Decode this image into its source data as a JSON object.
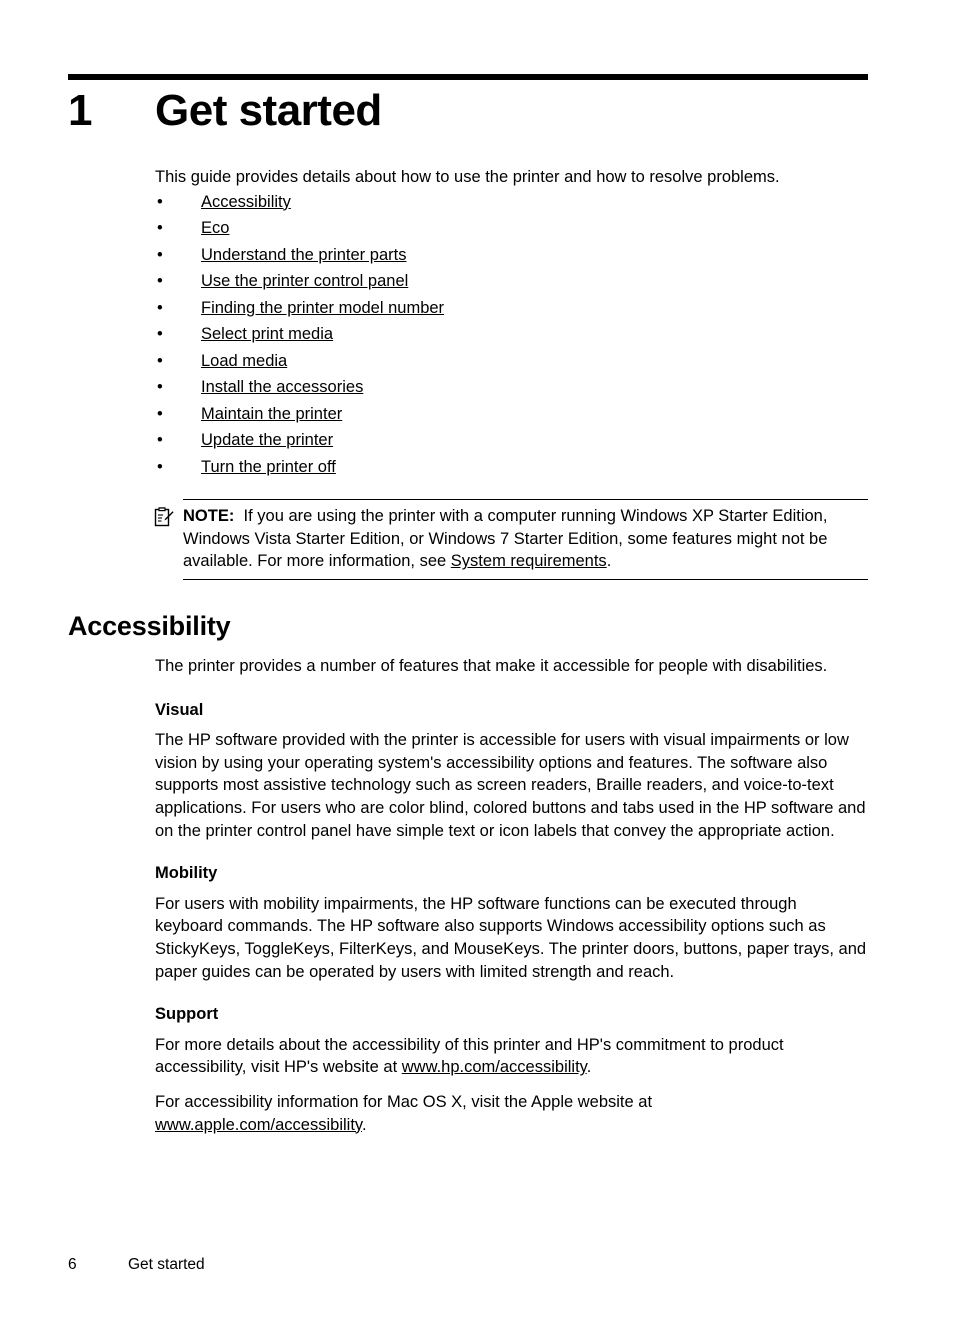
{
  "chapter": {
    "number": "1",
    "title": "Get started"
  },
  "intro": "This guide provides details about how to use the printer and how to resolve problems.",
  "bullet": "•",
  "links": [
    {
      "label": "Accessibility"
    },
    {
      "label": "Eco"
    },
    {
      "label": "Understand the printer parts"
    },
    {
      "label": "Use the printer control panel"
    },
    {
      "label": "Finding the printer model number"
    },
    {
      "label": "Select print media"
    },
    {
      "label": "Load media"
    },
    {
      "label": "Install the accessories"
    },
    {
      "label": "Maintain the printer"
    },
    {
      "label": "Update the printer"
    },
    {
      "label": "Turn the printer off"
    }
  ],
  "note": {
    "icon": "note-clipboard-pencil-icon",
    "label": "NOTE:",
    "text_before_link": "If you are using the printer with a computer running Windows XP Starter Edition, Windows Vista Starter Edition, or Windows 7 Starter Edition, some features might not be available. For more information, see ",
    "link": "System requirements",
    "text_after_link": "."
  },
  "section": {
    "heading": "Accessibility",
    "intro": "The printer provides a number of features that make it accessible for people with disabilities.",
    "subsections": [
      {
        "heading": "Visual",
        "paragraphs": [
          "The HP software provided with the printer is accessible for users with visual impairments or low vision by using your operating system's accessibility options and features. The software also supports most assistive technology such as screen readers, Braille readers, and voice-to-text applications. For users who are color blind, colored buttons and tabs used in the HP software and on the printer control panel have simple text or icon labels that convey the appropriate action."
        ]
      },
      {
        "heading": "Mobility",
        "paragraphs": [
          "For users with mobility impairments, the HP software functions can be executed through keyboard commands. The HP software also supports Windows accessibility options such as StickyKeys, ToggleKeys, FilterKeys, and MouseKeys. The printer doors, buttons, paper trays, and paper guides can be operated by users with limited strength and reach."
        ]
      }
    ],
    "support": {
      "heading": "Support",
      "para1_before": "For more details about the accessibility of this printer and HP's commitment to product accessibility, visit HP's website at ",
      "para1_link": "www.hp.com/accessibility",
      "para1_after": ".",
      "para2_before": "For accessibility information for Mac OS X, visit the Apple website at ",
      "para2_link": "www.apple.com/accessibility",
      "para2_after": "."
    }
  },
  "footer": {
    "page_number": "6",
    "label": "Get started"
  }
}
